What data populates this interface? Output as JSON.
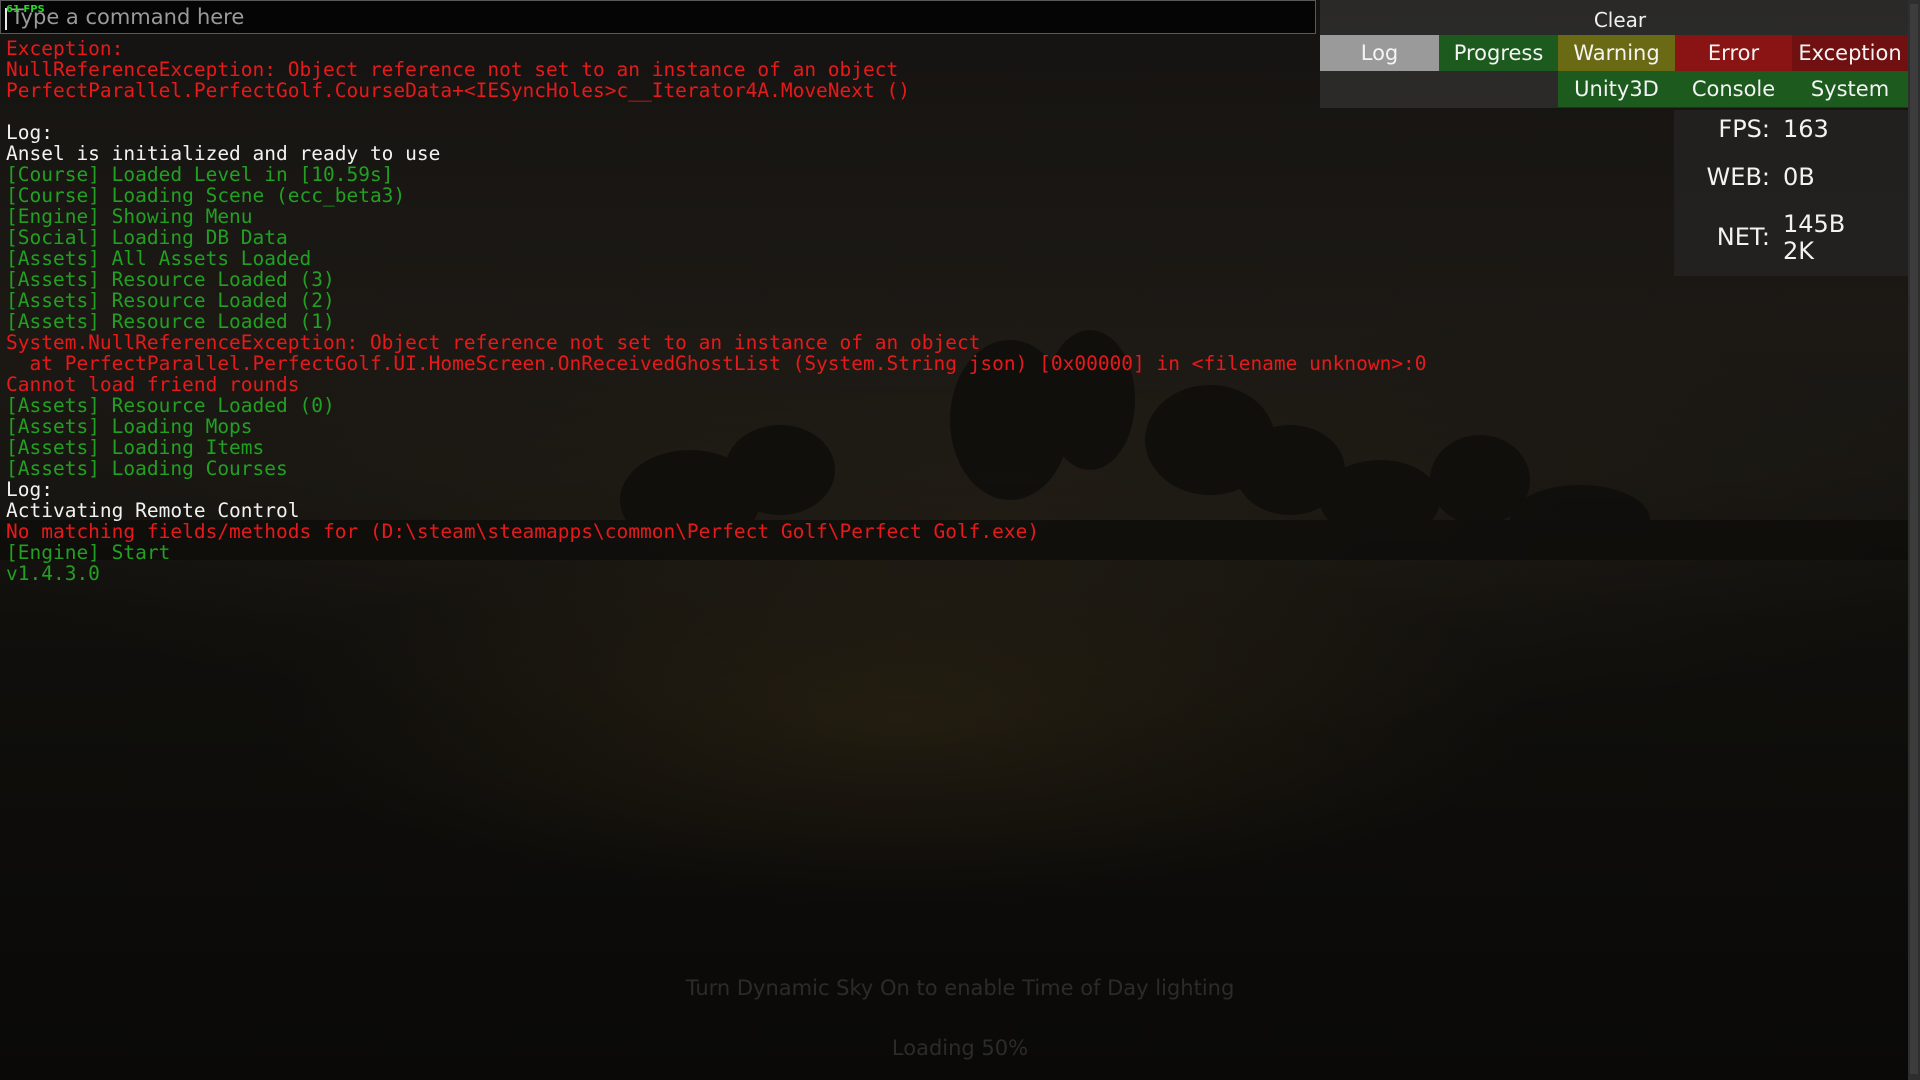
{
  "command_bar": {
    "placeholder": "Type a command here",
    "fps_overlay": "61 FPS"
  },
  "log_lines": [
    {
      "text": "Exception:",
      "color": "#e61a1a"
    },
    {
      "text": "NullReferenceException: Object reference not set to an instance of an object",
      "color": "#e61a1a"
    },
    {
      "text": "PerfectParallel.PerfectGolf.CourseData+<IESyncHoles>c__Iterator4A.MoveNext ()",
      "color": "#e61a1a"
    },
    {
      "text": "",
      "color": "#f2f2f2"
    },
    {
      "text": "Log:",
      "color": "#f2f2f2"
    },
    {
      "text": "Ansel is initialized and ready to use",
      "color": "#f2f2f2"
    },
    {
      "text": "[Course] Loaded Level in [10.59s]",
      "color": "#22a022"
    },
    {
      "text": "[Course] Loading Scene (ecc_beta3)",
      "color": "#22a022"
    },
    {
      "text": "[Engine] Showing Menu",
      "color": "#22a022"
    },
    {
      "text": "[Social] Loading DB Data",
      "color": "#22a022"
    },
    {
      "text": "[Assets] All Assets Loaded",
      "color": "#22a022"
    },
    {
      "text": "[Assets] Resource Loaded (3)",
      "color": "#22a022"
    },
    {
      "text": "[Assets] Resource Loaded (2)",
      "color": "#22a022"
    },
    {
      "text": "[Assets] Resource Loaded (1)",
      "color": "#22a022"
    },
    {
      "text": "System.NullReferenceException: Object reference not set to an instance of an object",
      "color": "#e61a1a"
    },
    {
      "text": "  at PerfectParallel.PerfectGolf.UI.HomeScreen.OnReceivedGhostList (System.String json) [0x00000] in <filename unknown>:0",
      "color": "#e61a1a"
    },
    {
      "text": "Cannot load friend rounds",
      "color": "#e61a1a"
    },
    {
      "text": "[Assets] Resource Loaded (0)",
      "color": "#22a022"
    },
    {
      "text": "[Assets] Loading Mops",
      "color": "#22a022"
    },
    {
      "text": "[Assets] Loading Items",
      "color": "#22a022"
    },
    {
      "text": "[Assets] Loading Courses",
      "color": "#22a022"
    },
    {
      "text": "Log:",
      "color": "#f2f2f2"
    },
    {
      "text": "Activating Remote Control",
      "color": "#f2f2f2"
    },
    {
      "text": "No matching fields/methods for (D:\\steam\\steamapps\\common\\Perfect Golf\\Perfect Golf.exe)",
      "color": "#e61a1a"
    },
    {
      "text": "[Engine] Start",
      "color": "#22a022"
    },
    {
      "text": "v1.4.3.0",
      "color": "#22a022"
    }
  ],
  "panel": {
    "clear_label": "Clear",
    "tabs_row1": [
      {
        "label": "Log",
        "bg": "#9a9a9a"
      },
      {
        "label": "Progress",
        "bg": "#1d5a1d"
      },
      {
        "label": "Warning",
        "bg": "#6a6a14"
      },
      {
        "label": "Error",
        "bg": "#8a1414"
      },
      {
        "label": "Exception",
        "bg": "#701010"
      }
    ],
    "tabs_row2": [
      {
        "label": "Unity3D",
        "bg": "#1d5a1d"
      },
      {
        "label": "Console",
        "bg": "#1d5a1d"
      },
      {
        "label": "System",
        "bg": "#1d5a1d"
      }
    ]
  },
  "stats": {
    "fps_label": "FPS:",
    "fps_value": "163",
    "web_label": "WEB:",
    "web_value": "0B",
    "net_label": "NET:",
    "net_value_line1": "145B",
    "net_value_line2": "2K"
  },
  "hints": {
    "dynamic_sky": "Turn Dynamic Sky On to enable Time of Day lighting",
    "loading": "Loading 50%"
  }
}
